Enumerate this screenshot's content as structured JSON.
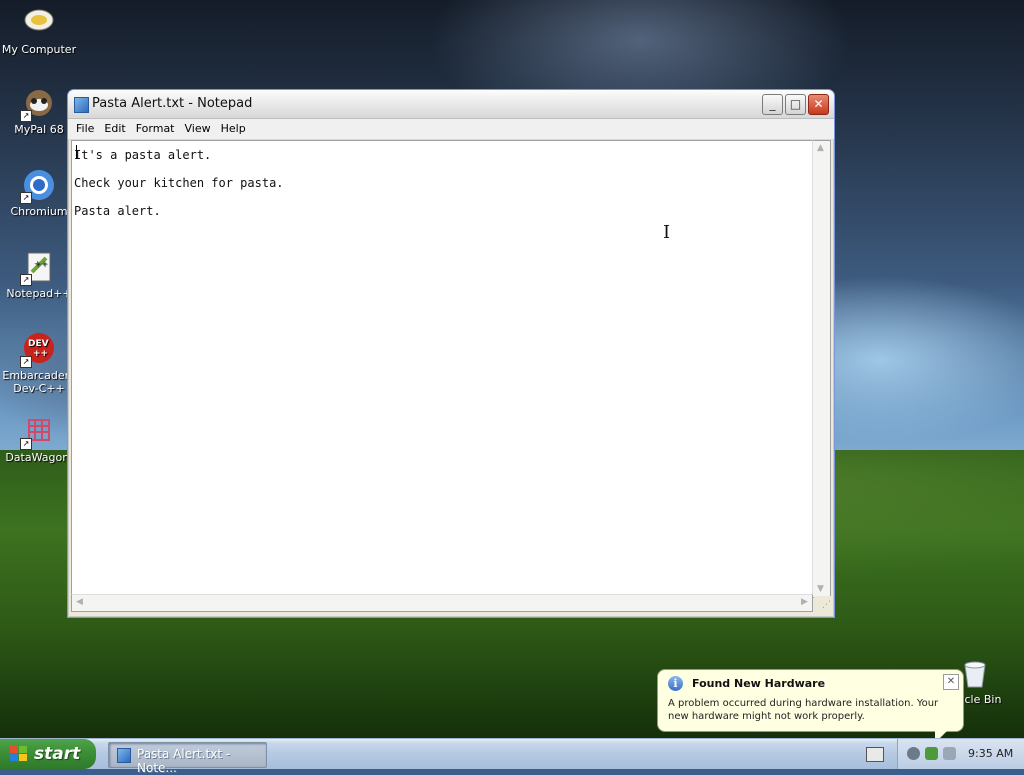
{
  "desktop": {
    "icons": [
      {
        "label": "My Computer"
      },
      {
        "label": "MyPal 68"
      },
      {
        "label": "Chromium"
      },
      {
        "label": "Notepad++"
      },
      {
        "label": "Embarcadero Dev-C++"
      },
      {
        "label": "DataWagon."
      }
    ],
    "recycle_bin": {
      "label": "ycle Bin"
    }
  },
  "window": {
    "title": "Pasta Alert.txt - Notepad",
    "menu": [
      "File",
      "Edit",
      "Format",
      "View",
      "Help"
    ],
    "content_lines": [
      "It's a pasta alert.",
      "Check your kitchen for pasta.",
      "Pasta alert."
    ]
  },
  "balloon": {
    "title": "Found New Hardware",
    "message": "A problem occurred during hardware installation. Your new hardware might not work properly."
  },
  "taskbar": {
    "start_label": "start",
    "task_button": "Pasta Alert.txt - Note...",
    "clock": "9:35 AM"
  },
  "colors": {
    "taskbar": "#b5c9e2",
    "start_green": "#3c8f37",
    "balloon_bg": "#ffffe1"
  }
}
